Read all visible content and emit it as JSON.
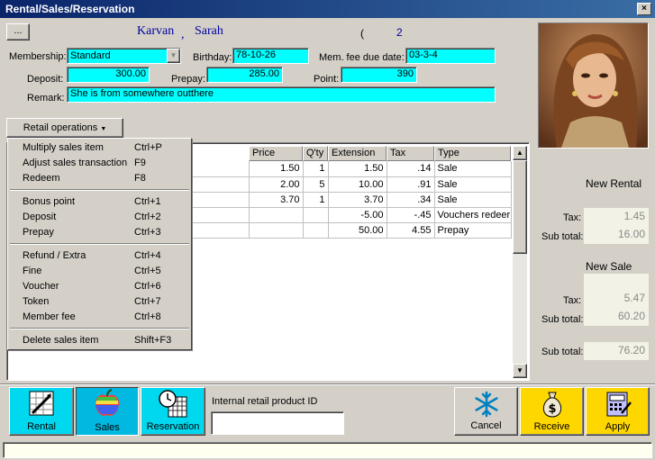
{
  "window": {
    "title": "Rental/Sales/Reservation",
    "close": "×"
  },
  "customer": {
    "browse_label": "...",
    "last_name": "Karvan",
    "separator": ",",
    "first_name": "Sarah",
    "count_open": "(",
    "count": "2",
    "membership_label": "Membership:",
    "membership_value": "Standard",
    "birthday_label": "Birthday:",
    "birthday_value": "78-10-26",
    "mem_fee_label": "Mem. fee due date:",
    "mem_fee_value": "03-3-4",
    "deposit_label": "Deposit:",
    "deposit_value": "300.00",
    "prepay_label": "Prepay:",
    "prepay_value": "285.00",
    "point_label": "Point:",
    "point_value": "390",
    "remark_label": "Remark:",
    "remark_value": "She is from somewhere outthere"
  },
  "retail_ops": {
    "label": "Retail operations"
  },
  "menu": {
    "items": [
      {
        "label": "Multiply sales item",
        "shortcut": "Ctrl+P"
      },
      {
        "label": "Adjust sales transaction",
        "shortcut": "F9"
      },
      {
        "label": "Redeem",
        "shortcut": "F8"
      },
      {
        "label": "Bonus point",
        "shortcut": "Ctrl+1"
      },
      {
        "label": "Deposit",
        "shortcut": "Ctrl+2"
      },
      {
        "label": "Prepay",
        "shortcut": "Ctrl+3"
      },
      {
        "label": "Refund / Extra",
        "shortcut": "Ctrl+4"
      },
      {
        "label": "Fine",
        "shortcut": "Ctrl+5"
      },
      {
        "label": "Voucher",
        "shortcut": "Ctrl+6"
      },
      {
        "label": "Token",
        "shortcut": "Ctrl+7"
      },
      {
        "label": "Member fee",
        "shortcut": "Ctrl+8"
      },
      {
        "label": "Delete sales item",
        "shortcut": "Shift+F3"
      }
    ]
  },
  "grid": {
    "headers": [
      "Price",
      "Q'ty",
      "Extension",
      "Tax",
      "Type"
    ],
    "rows": [
      [
        "1.50",
        "1",
        "1.50",
        ".14",
        "Sale"
      ],
      [
        "2.00",
        "5",
        "10.00",
        ".91",
        "Sale"
      ],
      [
        "3.70",
        "1",
        "3.70",
        ".34",
        "Sale"
      ],
      [
        "",
        "",
        "-5.00",
        "-.45",
        "Vouchers redeer"
      ],
      [
        "",
        "",
        "50.00",
        "4.55",
        "Prepay"
      ]
    ]
  },
  "summary": {
    "new_rental_label": "New Rental",
    "rental_tax_label": "Tax:",
    "rental_tax": "1.45",
    "rental_subtotal_label": "Sub total:",
    "rental_subtotal": "16.00",
    "new_sale_label": "New Sale",
    "sale_tax_label": "Tax:",
    "sale_tax": "5.47",
    "sale_subtotal_label": "Sub total:",
    "sale_subtotal": "60.20",
    "grand_subtotal_label": "Sub total:",
    "grand_subtotal": "76.20"
  },
  "toolbar": {
    "rental": "Rental",
    "sales": "Sales",
    "reservation": "Reservation",
    "product_id_label": "Internal retail product ID",
    "product_id_value": "",
    "cancel": "Cancel",
    "receive": "Receive",
    "apply": "Apply"
  },
  "colors": {
    "field": "#00ffff",
    "tab_active": "#00e0ff",
    "action_yellow": "#ffd700",
    "title_blue": "#0a246a"
  }
}
